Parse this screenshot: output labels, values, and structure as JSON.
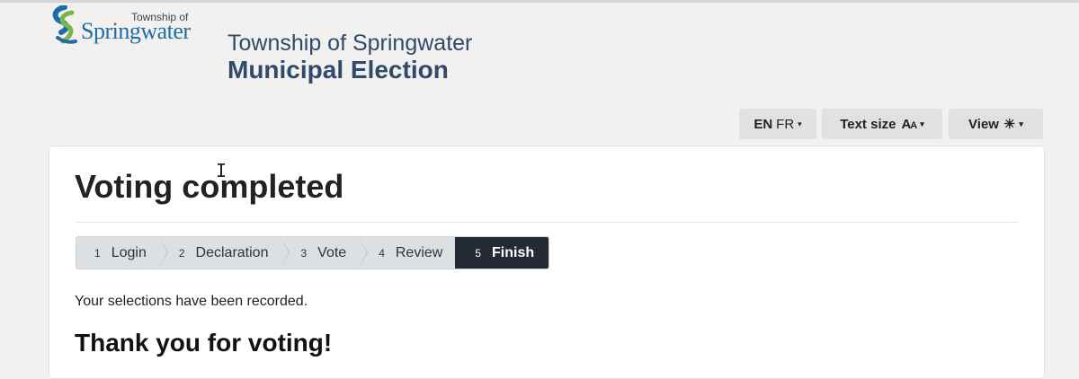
{
  "header": {
    "logo_small": "Township of",
    "logo_big": "Springwater",
    "title": "Township of Springwater",
    "subtitle": "Municipal Election"
  },
  "toolbar": {
    "lang_en": "EN",
    "lang_fr": "FR",
    "text_size_label": "Text size",
    "text_size_icon": "AA",
    "view_label": "View"
  },
  "main": {
    "heading": "Voting completed",
    "steps": [
      {
        "num": "1",
        "label": "Login"
      },
      {
        "num": "2",
        "label": "Declaration"
      },
      {
        "num": "3",
        "label": "Vote"
      },
      {
        "num": "4",
        "label": "Review"
      },
      {
        "num": "5",
        "label": "Finish",
        "active": true
      }
    ],
    "message": "Your selections have been recorded.",
    "thanks": "Thank you for voting!"
  },
  "colors": {
    "background": "#f3f1f0",
    "title": "#2e4a6c",
    "active_step": "#232a34"
  }
}
